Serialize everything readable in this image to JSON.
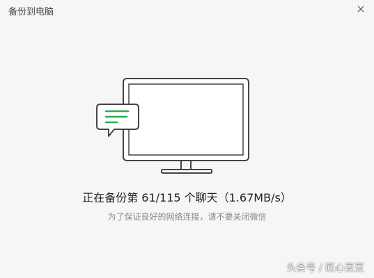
{
  "window": {
    "title": "备份到电脑",
    "close_icon": "close-icon"
  },
  "illustration": {
    "icons": [
      "monitor-icon",
      "chat-bubble-icon"
    ],
    "accent_color": "#2aae4a",
    "outline_color": "#444444"
  },
  "status": {
    "progress_text": "正在备份第 61/115 个聊天（1.67MB/s）",
    "hint": "为了保证良好的网络连接，请不要关闭微信"
  },
  "watermark": {
    "text": "头条号 / 匠心豆豆"
  }
}
